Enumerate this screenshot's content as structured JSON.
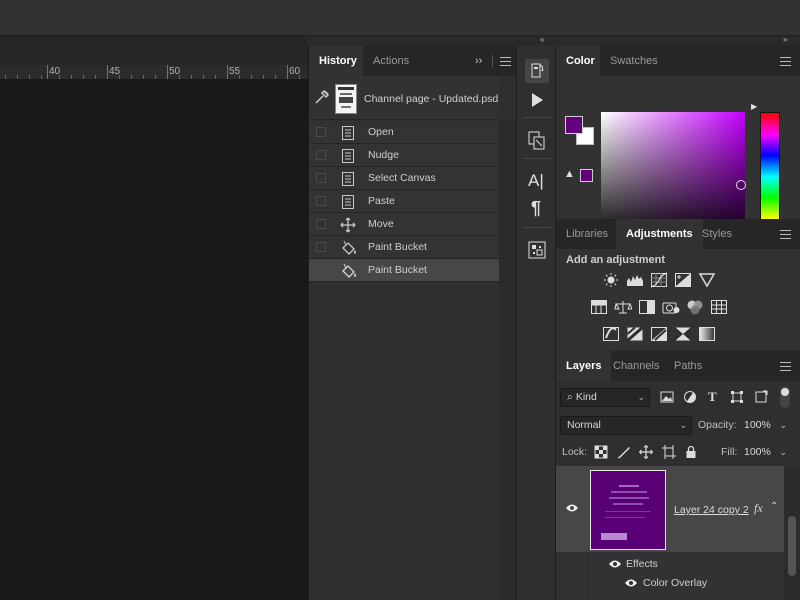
{
  "topbar": {
    "collapse_right": "«",
    "collapse_far_right": "»"
  },
  "ruler": {
    "labels": [
      "40",
      "45",
      "50",
      "55",
      "60"
    ]
  },
  "history_panel": {
    "tabs": [
      {
        "label": "History",
        "active": true
      },
      {
        "label": "Actions",
        "active": false
      }
    ],
    "expand_glyph": "››",
    "snapshot": {
      "label": "Channel page - Updated.psd"
    },
    "items": [
      {
        "label": "Open",
        "icon": "document-icon",
        "selected": false
      },
      {
        "label": "Nudge",
        "icon": "document-icon",
        "selected": false
      },
      {
        "label": "Select Canvas",
        "icon": "document-icon",
        "selected": false
      },
      {
        "label": "Paste",
        "icon": "document-icon",
        "selected": false
      },
      {
        "label": "Move",
        "icon": "move-icon",
        "selected": false
      },
      {
        "label": "Paint Bucket",
        "icon": "paint-bucket-icon",
        "selected": false
      },
      {
        "label": "Paint Bucket",
        "icon": "paint-bucket-icon",
        "selected": true
      }
    ]
  },
  "tool_strip": {
    "tools": [
      "history-brush-icon",
      "play-icon",
      "layer-comps-icon",
      "character-icon",
      "paragraph-icon",
      "navigator-icon"
    ],
    "character_glyph": "A|",
    "paragraph_glyph": "¶"
  },
  "color_panel": {
    "tabs": [
      {
        "label": "Color",
        "active": true
      },
      {
        "label": "Swatches",
        "active": false
      }
    ],
    "foreground": "#640080",
    "background": "#ffffff",
    "warning_glyph": "▲"
  },
  "adjustments_panel": {
    "tabs": [
      {
        "label": "Libraries",
        "active": false
      },
      {
        "label": "Adjustments",
        "active": true
      },
      {
        "label": "Styles",
        "active": false
      }
    ],
    "heading": "Add an adjustment",
    "rows": [
      [
        "brightness-contrast-icon",
        "levels-icon",
        "curves-icon",
        "exposure-icon",
        "vibrance-icon"
      ],
      [
        "hue-saturation-icon",
        "color-balance-icon",
        "black-white-icon",
        "photo-filter-icon",
        "channel-mixer-icon",
        "color-lookup-icon"
      ],
      [
        "invert-icon",
        "posterize-icon",
        "threshold-icon",
        "selective-color-icon",
        "gradient-map-icon"
      ]
    ]
  },
  "layers_panel": {
    "tabs": [
      {
        "label": "Layers",
        "active": true
      },
      {
        "label": "Channels",
        "active": false
      },
      {
        "label": "Paths",
        "active": false
      }
    ],
    "filter": {
      "label": "Kind",
      "search_glyph": "⌕"
    },
    "blend_mode": "Normal",
    "opacity": {
      "label": "Opacity:",
      "value": "100%"
    },
    "lock": {
      "label": "Lock:"
    },
    "fill": {
      "label": "Fill:",
      "value": "100%"
    },
    "layer": {
      "name": "Layer 24 copy 2",
      "fx": "fx",
      "effects_label": "Effects",
      "effect_item": "Color Overlay"
    }
  }
}
